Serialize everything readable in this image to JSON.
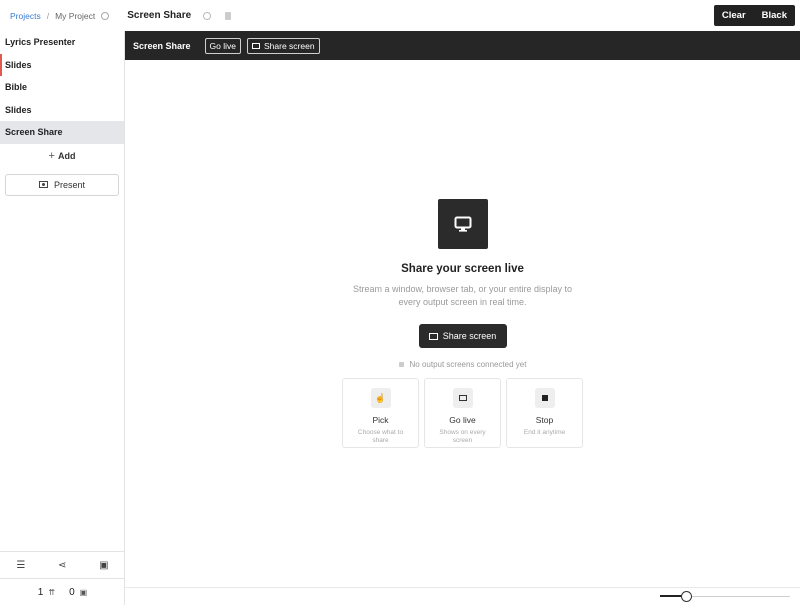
{
  "breadcrumb": {
    "root": "Projects",
    "separator": "/",
    "project": "My Project"
  },
  "page": {
    "title": "Screen Share"
  },
  "topbar": {
    "clear_label": "Clear",
    "black_label": "Black"
  },
  "sidebar": {
    "items": [
      {
        "label": "Lyrics Presenter"
      },
      {
        "label": "Slides"
      },
      {
        "label": "Bible"
      },
      {
        "label": "Slides"
      },
      {
        "label": "Screen Share"
      }
    ],
    "add_label": "Add",
    "present_label": "Present",
    "counts": {
      "first": "1",
      "second": "0"
    }
  },
  "main": {
    "header_title": "Screen Share",
    "go_live_label": "Go live",
    "share_screen_label": "Share screen",
    "hero_title": "Share your screen live",
    "hero_desc": "Stream a window, browser tab, or your entire display to every output screen in real time.",
    "hero_button": "Share screen",
    "status_text": "No output screens connected yet",
    "steps": [
      {
        "label": "Pick",
        "desc": "Choose what to share",
        "icon": "pointer-hand-icon"
      },
      {
        "label": "Go live",
        "desc": "Shows on every screen",
        "icon": "monitor-icon"
      },
      {
        "label": "Stop",
        "desc": "End it anytime",
        "icon": "stop-icon"
      }
    ]
  },
  "zoom": {
    "level": 0.2
  },
  "colors": {
    "accent_marker": "#e05a4f",
    "dark": "#262626",
    "link": "#3b7bd4"
  }
}
